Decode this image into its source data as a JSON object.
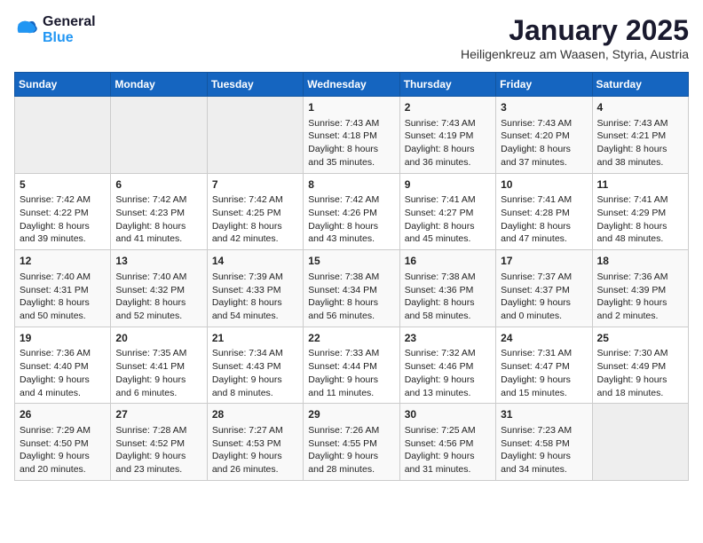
{
  "logo": {
    "line1": "General",
    "line2": "Blue"
  },
  "title": "January 2025",
  "location": "Heiligenkreuz am Waasen, Styria, Austria",
  "days_of_week": [
    "Sunday",
    "Monday",
    "Tuesday",
    "Wednesday",
    "Thursday",
    "Friday",
    "Saturday"
  ],
  "weeks": [
    [
      {
        "day": "",
        "content": ""
      },
      {
        "day": "",
        "content": ""
      },
      {
        "day": "",
        "content": ""
      },
      {
        "day": "1",
        "content": "Sunrise: 7:43 AM\nSunset: 4:18 PM\nDaylight: 8 hours and 35 minutes."
      },
      {
        "day": "2",
        "content": "Sunrise: 7:43 AM\nSunset: 4:19 PM\nDaylight: 8 hours and 36 minutes."
      },
      {
        "day": "3",
        "content": "Sunrise: 7:43 AM\nSunset: 4:20 PM\nDaylight: 8 hours and 37 minutes."
      },
      {
        "day": "4",
        "content": "Sunrise: 7:43 AM\nSunset: 4:21 PM\nDaylight: 8 hours and 38 minutes."
      }
    ],
    [
      {
        "day": "5",
        "content": "Sunrise: 7:42 AM\nSunset: 4:22 PM\nDaylight: 8 hours and 39 minutes."
      },
      {
        "day": "6",
        "content": "Sunrise: 7:42 AM\nSunset: 4:23 PM\nDaylight: 8 hours and 41 minutes."
      },
      {
        "day": "7",
        "content": "Sunrise: 7:42 AM\nSunset: 4:25 PM\nDaylight: 8 hours and 42 minutes."
      },
      {
        "day": "8",
        "content": "Sunrise: 7:42 AM\nSunset: 4:26 PM\nDaylight: 8 hours and 43 minutes."
      },
      {
        "day": "9",
        "content": "Sunrise: 7:41 AM\nSunset: 4:27 PM\nDaylight: 8 hours and 45 minutes."
      },
      {
        "day": "10",
        "content": "Sunrise: 7:41 AM\nSunset: 4:28 PM\nDaylight: 8 hours and 47 minutes."
      },
      {
        "day": "11",
        "content": "Sunrise: 7:41 AM\nSunset: 4:29 PM\nDaylight: 8 hours and 48 minutes."
      }
    ],
    [
      {
        "day": "12",
        "content": "Sunrise: 7:40 AM\nSunset: 4:31 PM\nDaylight: 8 hours and 50 minutes."
      },
      {
        "day": "13",
        "content": "Sunrise: 7:40 AM\nSunset: 4:32 PM\nDaylight: 8 hours and 52 minutes."
      },
      {
        "day": "14",
        "content": "Sunrise: 7:39 AM\nSunset: 4:33 PM\nDaylight: 8 hours and 54 minutes."
      },
      {
        "day": "15",
        "content": "Sunrise: 7:38 AM\nSunset: 4:34 PM\nDaylight: 8 hours and 56 minutes."
      },
      {
        "day": "16",
        "content": "Sunrise: 7:38 AM\nSunset: 4:36 PM\nDaylight: 8 hours and 58 minutes."
      },
      {
        "day": "17",
        "content": "Sunrise: 7:37 AM\nSunset: 4:37 PM\nDaylight: 9 hours and 0 minutes."
      },
      {
        "day": "18",
        "content": "Sunrise: 7:36 AM\nSunset: 4:39 PM\nDaylight: 9 hours and 2 minutes."
      }
    ],
    [
      {
        "day": "19",
        "content": "Sunrise: 7:36 AM\nSunset: 4:40 PM\nDaylight: 9 hours and 4 minutes."
      },
      {
        "day": "20",
        "content": "Sunrise: 7:35 AM\nSunset: 4:41 PM\nDaylight: 9 hours and 6 minutes."
      },
      {
        "day": "21",
        "content": "Sunrise: 7:34 AM\nSunset: 4:43 PM\nDaylight: 9 hours and 8 minutes."
      },
      {
        "day": "22",
        "content": "Sunrise: 7:33 AM\nSunset: 4:44 PM\nDaylight: 9 hours and 11 minutes."
      },
      {
        "day": "23",
        "content": "Sunrise: 7:32 AM\nSunset: 4:46 PM\nDaylight: 9 hours and 13 minutes."
      },
      {
        "day": "24",
        "content": "Sunrise: 7:31 AM\nSunset: 4:47 PM\nDaylight: 9 hours and 15 minutes."
      },
      {
        "day": "25",
        "content": "Sunrise: 7:30 AM\nSunset: 4:49 PM\nDaylight: 9 hours and 18 minutes."
      }
    ],
    [
      {
        "day": "26",
        "content": "Sunrise: 7:29 AM\nSunset: 4:50 PM\nDaylight: 9 hours and 20 minutes."
      },
      {
        "day": "27",
        "content": "Sunrise: 7:28 AM\nSunset: 4:52 PM\nDaylight: 9 hours and 23 minutes."
      },
      {
        "day": "28",
        "content": "Sunrise: 7:27 AM\nSunset: 4:53 PM\nDaylight: 9 hours and 26 minutes."
      },
      {
        "day": "29",
        "content": "Sunrise: 7:26 AM\nSunset: 4:55 PM\nDaylight: 9 hours and 28 minutes."
      },
      {
        "day": "30",
        "content": "Sunrise: 7:25 AM\nSunset: 4:56 PM\nDaylight: 9 hours and 31 minutes."
      },
      {
        "day": "31",
        "content": "Sunrise: 7:23 AM\nSunset: 4:58 PM\nDaylight: 9 hours and 34 minutes."
      },
      {
        "day": "",
        "content": ""
      }
    ]
  ]
}
